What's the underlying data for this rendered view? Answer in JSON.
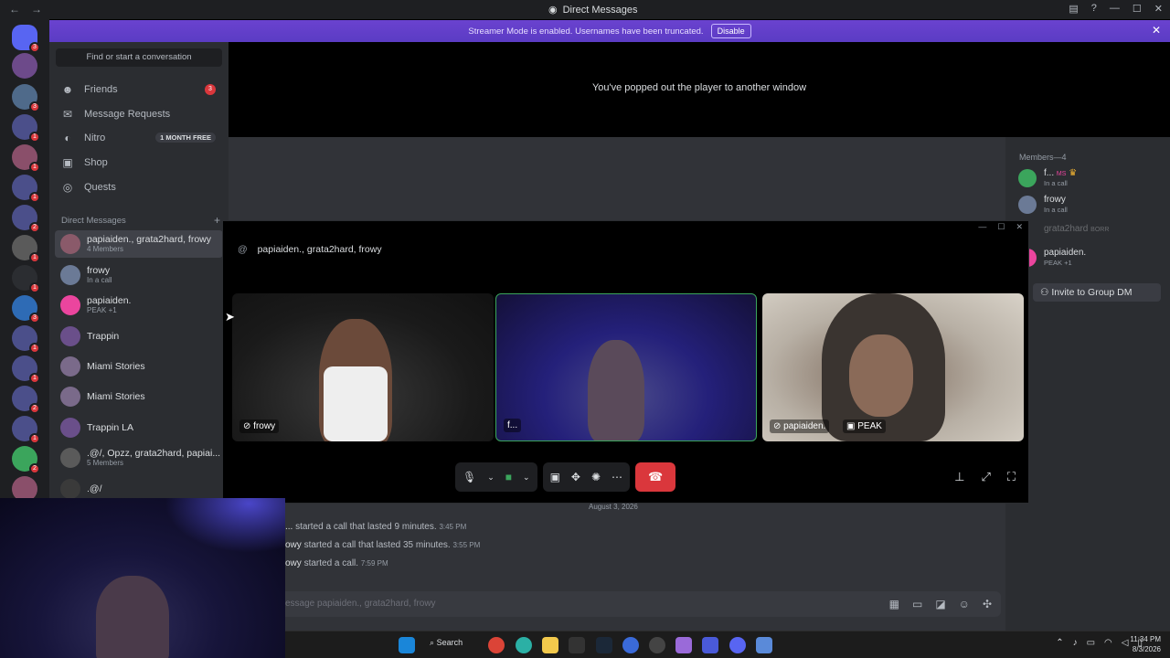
{
  "window": {
    "title": "Direct Messages"
  },
  "banner": {
    "text": "Streamer Mode is enabled. Usernames have been truncated.",
    "button": "Disable"
  },
  "sidebar": {
    "search_placeholder": "Find or start a conversation",
    "nav": [
      {
        "label": "Friends",
        "icon": "friends-icon",
        "badge": "3"
      },
      {
        "label": "Message Requests",
        "icon": "mail-icon"
      },
      {
        "label": "Nitro",
        "icon": "nitro-icon",
        "promo": "1 MONTH FREE"
      },
      {
        "label": "Shop",
        "icon": "shop-icon"
      },
      {
        "label": "Quests",
        "icon": "quests-icon"
      }
    ],
    "dm_header": "Direct Messages",
    "dms": [
      {
        "name": "papiaiden., grata2hard, frowy",
        "sub": "4 Members"
      },
      {
        "name": "frowy",
        "sub": "In a call"
      },
      {
        "name": "papiaiden.",
        "sub": "PEAK +1"
      },
      {
        "name": "Trappin"
      },
      {
        "name": "Miami Stories"
      },
      {
        "name": "Miami Stories"
      },
      {
        "name": "Trappin LA"
      },
      {
        "name": ".@/, Opzz, grata2hard, papiai...",
        "sub": "5 Members"
      },
      {
        "name": ".@/"
      }
    ]
  },
  "popout": {
    "text": "You've popped out the player to another window"
  },
  "call": {
    "title": "papiaiden., grata2hard, frowy",
    "tiles": [
      {
        "label": "frowy"
      },
      {
        "label": "f..."
      },
      {
        "label": "papiaiden.",
        "activity": "PEAK"
      }
    ]
  },
  "members": {
    "header": "Members—4",
    "list": [
      {
        "name": "f...",
        "tag": "MS",
        "sub": "In a call"
      },
      {
        "name": "frowy",
        "sub": "In a call"
      },
      {
        "name": "grata2hard",
        "tag": "BORR"
      },
      {
        "name": "papiaiden.",
        "sub": "PEAK +1"
      }
    ],
    "invite": "Invite to Group DM"
  },
  "chat": {
    "date": "August 3, 2026",
    "messages": [
      {
        "who": "...",
        "text": "started a call that lasted 9 minutes.",
        "time": "3:45 PM"
      },
      {
        "who": "owy",
        "text": "started a call that lasted 35 minutes.",
        "time": "3:55 PM"
      },
      {
        "who": "owy",
        "text": "started a call.",
        "time": "7:59 PM"
      }
    ],
    "composer_placeholder": "essage papiaiden., grata2hard, frowy"
  },
  "taskbar": {
    "search": "Search",
    "time": "11:34 PM",
    "date": "8/3/2026"
  },
  "colors": {
    "banner": "#5b3cc4",
    "accent": "#5865f2",
    "danger": "#da373c",
    "online": "#3ba55c"
  }
}
